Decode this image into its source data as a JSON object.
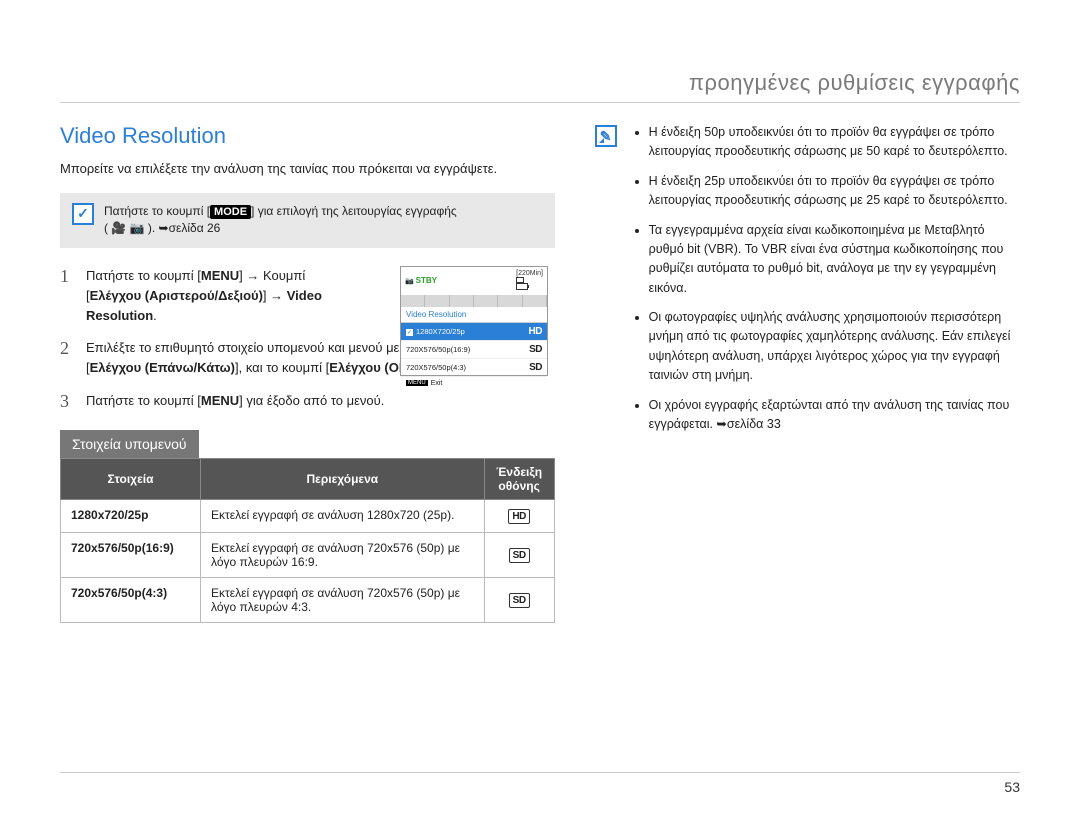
{
  "header": {
    "title": "προηγμένες ρυθμίσεις εγγραφής"
  },
  "section": {
    "title": "Video Resolution"
  },
  "lead": "Μπορείτε να επιλέξετε την ανάλυση της ταινίας που πρόκειται να εγγράψετε.",
  "tip": {
    "prefix": "Πατήστε το κουμπί [",
    "mode": "MODE",
    "suffix": "] για επιλογή της λειτουργίας εγγραφής",
    "line2": "( 🎥  📷 ). ➥σελίδα 26"
  },
  "steps": [
    {
      "n": "1",
      "parts": {
        "a": "Πατήστε το κουμπί [",
        "menu": "MENU",
        "b": "] → Κουμπί [",
        "bold1": "Ελέγχου (Αριστερού/Δεξιού)",
        "c": "] → ",
        "bold2": "Video Resolution",
        "d": "."
      }
    },
    {
      "n": "2",
      "parts": {
        "a": "Επιλέξτε το επιθυμητό στοιχείο υπομενού και μενού με το κουμπί [",
        "bold1": "Ελέγχου (Επάνω/Κάτω)",
        "b": "], και το κουμπί [",
        "bold2": "Ελέγχου (OK)",
        "c": "]."
      }
    },
    {
      "n": "3",
      "parts": {
        "a": "Πατήστε το κουμπί [",
        "menu": "MENU",
        "b": "] για έξοδο από το μενού."
      }
    }
  ],
  "lcd": {
    "stby": "STBY",
    "mins": "[220Min]",
    "title": "Video Resolution",
    "items": [
      {
        "label": "1280X720/25p",
        "badge": "HD",
        "selected": true
      },
      {
        "label": "720X576/50p(16:9)",
        "badge": "SD",
        "selected": false
      },
      {
        "label": "720X576/50p(4:3)",
        "badge": "SD",
        "selected": false
      }
    ],
    "exit_menu": "MENU",
    "exit": "Exit"
  },
  "submenu_header": "Στοιχεία υπομενού",
  "table": {
    "headers": {
      "col1": "Στοιχεία",
      "col2": "Περιεχόμενα",
      "col3": "Ένδειξη οθόνης"
    },
    "rows": [
      {
        "item": "1280x720/25p",
        "desc": "Εκτελεί εγγραφή σε ανάλυση 1280x720 (25p).",
        "badge": "HD"
      },
      {
        "item": "720x576/50p(16:9)",
        "desc": "Εκτελεί εγγραφή σε ανάλυση 720x576 (50p) με λόγο πλευρών 16:9.",
        "badge": "SD"
      },
      {
        "item": "720x576/50p(4:3)",
        "desc": "Εκτελεί εγγραφή σε ανάλυση 720x576 (50p) με λόγο πλευρών 4:3.",
        "badge": "SD"
      }
    ]
  },
  "notes": [
    "Η ένδειξη 50p υποδεικνύει ότι το προϊόν θα εγγράψει σε τρόπο λειτουργίας προοδευτικής σάρωσης με 50 καρέ το δευτερόλεπτο.",
    "Η ένδειξη 25p υποδεικνύει ότι το προϊόν θα εγγράψει σε τρόπο λειτουργίας προοδευτικής σάρωσης με 25 καρέ το δευτερόλεπτο.",
    "Τα εγγεγραμμένα αρχεία είναι κωδικοποιημένα με Μεταβλητό ρυθμό bit (VBR). Το VBR είναι ένα σύστημα κωδικοποίησης που ρυθμίζει αυτόματα το ρυθμό bit, ανάλογα με την εγ γεγραμμένη εικόνα.",
    "Οι φωτογραφίες υψηλής ανάλυσης χρησιμοποιούν περισσότερη μνήμη από τις φωτογραφίες χαμηλότερης ανάλυσης. Εάν επιλεγεί υψηλότερη ανάλυση, υπάρχει λιγότερος χώρος για την εγγραφή ταινιών στη μνήμη.",
    "Οι χρόνοι εγγραφής εξαρτώνται από την ανάλυση της ταινίας που εγγράφεται. ➥σελίδα 33"
  ],
  "page_number": "53"
}
